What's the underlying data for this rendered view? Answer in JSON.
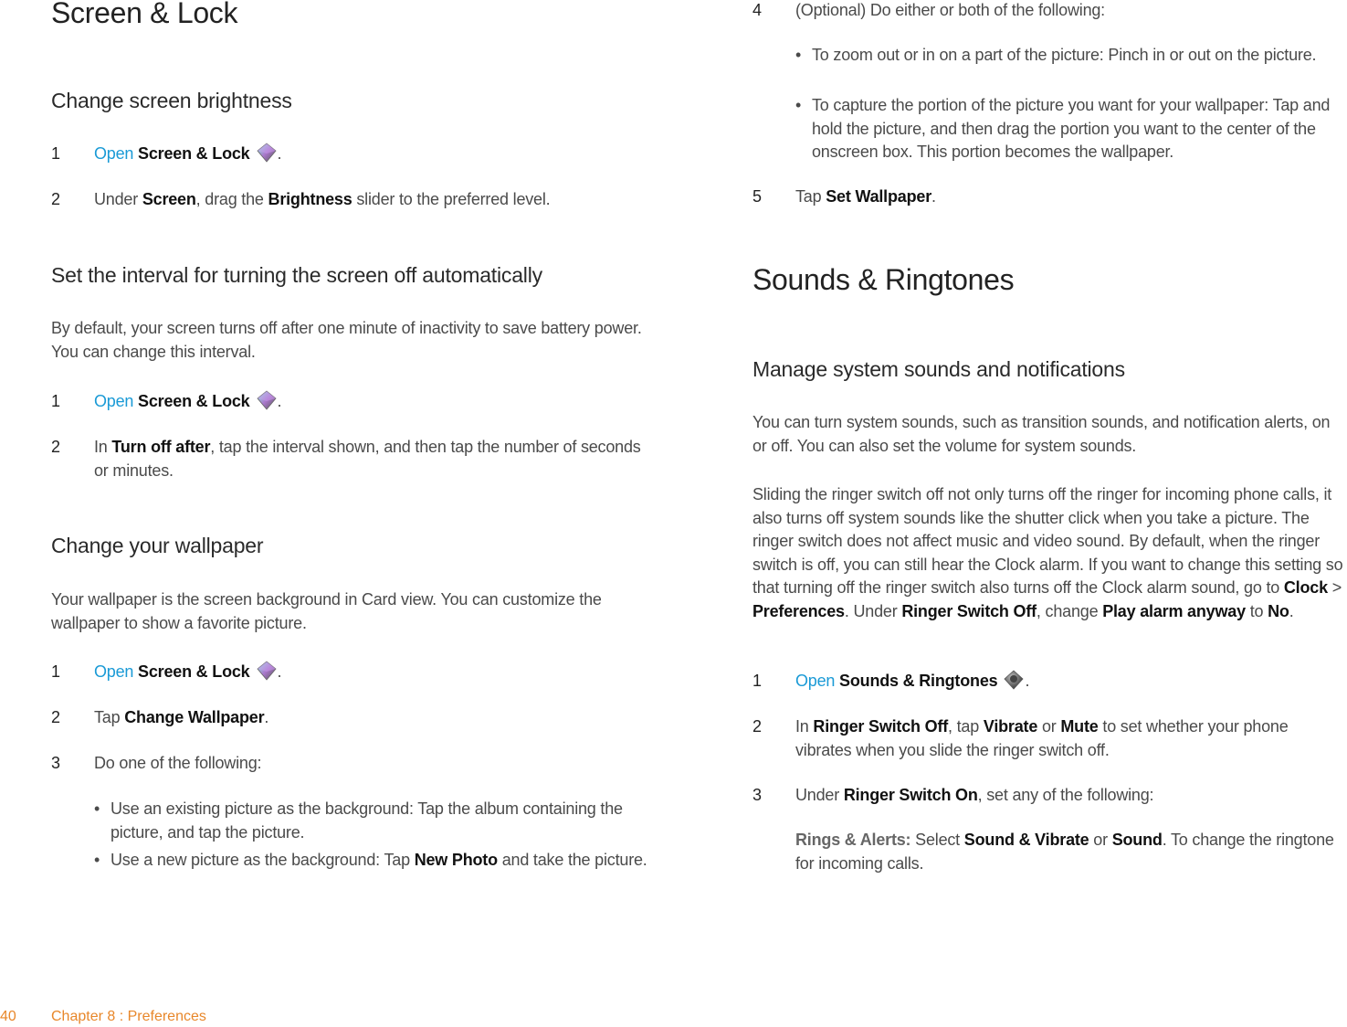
{
  "footer": {
    "page_number": "40",
    "chapter": "Chapter 8  :  Preferences",
    "color": "#e8872a"
  },
  "left": {
    "title": "Screen & Lock",
    "brightness": {
      "heading": "Change screen brightness",
      "steps": [
        {
          "num": "1",
          "link": "Open",
          "app": "Screen & Lock",
          "end": "."
        },
        {
          "num": "2",
          "t1": "Under ",
          "b1": "Screen",
          "t2": ", drag the ",
          "b2": "Brightness",
          "t3": " slider to the preferred level."
        }
      ]
    },
    "interval": {
      "heading": "Set the interval for turning the screen off automatically",
      "intro": "By default, your screen turns off after one minute of inactivity to save battery power. You can change this interval.",
      "steps": [
        {
          "num": "1",
          "link": "Open",
          "app": "Screen & Lock",
          "end": "."
        },
        {
          "num": "2",
          "t1": "In ",
          "b1": "Turn off after",
          "t2": ", tap the interval shown, and then tap the number of seconds or minutes."
        }
      ]
    },
    "wallpaper": {
      "heading": "Change your wallpaper",
      "intro": "Your wallpaper is the screen background in Card view. You can customize the wallpaper to show a favorite picture.",
      "steps": [
        {
          "num": "1",
          "link": "Open",
          "app": "Screen & Lock",
          "end": "."
        },
        {
          "num": "2",
          "t1": "Tap ",
          "b1": "Change Wallpaper",
          "t2": "."
        },
        {
          "num": "3",
          "t1": "Do one of the following:"
        }
      ],
      "bullets": [
        {
          "t1": "Use an existing picture as the background: Tap the album containing the picture, and tap the picture."
        },
        {
          "t1": "Use a new picture as the background: Tap ",
          "b1": "New Photo",
          "t2": " and take the picture."
        }
      ]
    }
  },
  "right": {
    "wallpaper_cont": {
      "steps": [
        {
          "num": "4",
          "t1": "(Optional) Do either or both of the following:"
        },
        {
          "num": "5",
          "t1": "Tap ",
          "b1": "Set Wallpaper",
          "t2": "."
        }
      ],
      "bullets": [
        {
          "t1": "To zoom out or in on a part of the picture: Pinch in or out on the picture."
        },
        {
          "t1": "To capture the portion of the picture you want for your wallpaper: Tap and hold the picture, and then drag the portion you want to the center of the onscreen box. This portion becomes the wallpaper."
        }
      ]
    },
    "title": "Sounds & Ringtones",
    "sounds": {
      "heading": "Manage system sounds and notifications",
      "intro": "You can turn system sounds, such as transition sounds, and notification alerts, on or off. You can also set the volume for system sounds.",
      "para2": {
        "t1": "Sliding the ringer switch off not only turns off the ringer for incoming phone calls, it also turns off system sounds like the shutter click when you take a picture. The ringer switch does not affect music and video sound. By default, when the ringer switch is off, you can still hear the Clock alarm. If you want to change this setting so that turning off the ringer switch also turns off the Clock alarm sound, go to ",
        "b1": "Clock",
        "t2": " > ",
        "b2": "Preferences",
        "t3": ". Under ",
        "b3": "Ringer Switch Off",
        "t4": ", change ",
        "b4": "Play alarm anyway",
        "t5": " to ",
        "b5": "No",
        "t6": "."
      },
      "steps": [
        {
          "num": "1",
          "link": "Open",
          "app": "Sounds & Ringtones",
          "end": "."
        },
        {
          "num": "2",
          "t1": "In ",
          "b1": "Ringer Switch Off",
          "t2": ", tap ",
          "b2": "Vibrate",
          "t3": " or ",
          "b3": "Mute",
          "t4": " to set whether your phone vibrates when you slide the ringer switch off."
        },
        {
          "num": "3",
          "t1": "Under ",
          "b1": "Ringer Switch On",
          "t2": ", set any of the following:"
        }
      ],
      "sub": {
        "label": "Rings & Alerts:",
        "t1": " Select ",
        "b1": "Sound & Vibrate",
        "t2": " or ",
        "b2": "Sound",
        "t3": ". To change the ringtone for incoming calls."
      }
    }
  },
  "colors": {
    "link": "#1a9ad6",
    "body_text": "#4a4a4a",
    "footer": "#e8872a"
  }
}
